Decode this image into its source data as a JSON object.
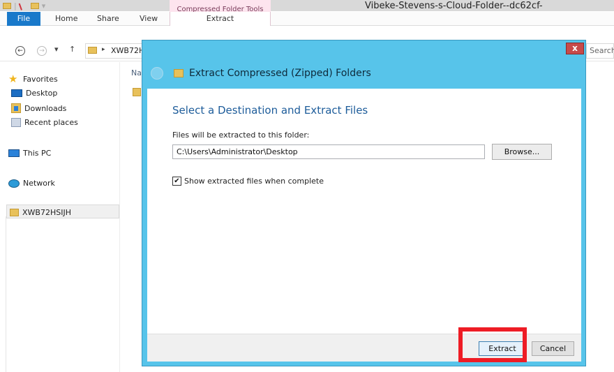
{
  "explorer": {
    "window_title": "Vibeke-Stevens-s-Cloud-Folder--dc62cf-",
    "contextual_group": "Compressed Folder Tools",
    "tabs": {
      "file": "File",
      "home": "Home",
      "share": "Share",
      "view": "View",
      "extract": "Extract"
    },
    "address": {
      "path": "XWB72H",
      "search_placeholder": "Search"
    },
    "nav": {
      "favorites": "Favorites",
      "desktop": "Desktop",
      "downloads": "Downloads",
      "recent_places": "Recent places",
      "this_pc": "This PC",
      "network": "Network",
      "folder": "XWB72HSIJH"
    },
    "content_header": "Na"
  },
  "dialog": {
    "title": "Extract Compressed (Zipped) Folders",
    "close_label": "x",
    "heading": "Select a Destination and Extract Files",
    "destination_label": "Files will be extracted to this folder:",
    "destination_value": "C:\\Users\\Administrator\\Desktop",
    "browse_label": "Browse...",
    "show_files_label": "Show extracted files when complete",
    "show_files_checked": true,
    "extract_label": "Extract",
    "cancel_label": "Cancel"
  },
  "colors": {
    "dialog_frame": "#57c4ea",
    "heading_blue": "#1d5c9a",
    "highlight_red": "#ee1c25",
    "file_tab": "#1979ca"
  }
}
